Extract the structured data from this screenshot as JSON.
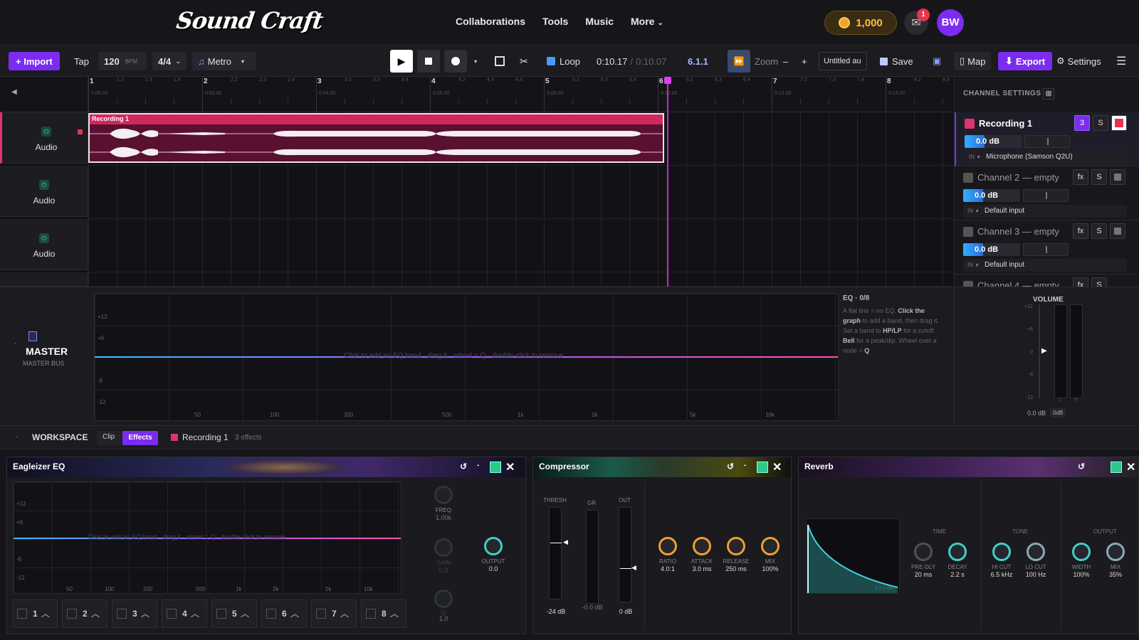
{
  "nav": {
    "brand": "Sound Craft",
    "links": [
      "Collaborations",
      "Tools",
      "Music",
      "More"
    ],
    "coins": "1,000",
    "mail_badge": "1",
    "avatar": "BW"
  },
  "toolbar": {
    "import": "+ Import",
    "tap": "Tap",
    "bpm": "120",
    "bpm_unit": "BPM",
    "time_sig": "4/4",
    "metro": "Metro",
    "loop": "Loop",
    "time_current": "0:10.17",
    "time_sep": "/",
    "time_total": "0:10.07",
    "position": "6.1.1",
    "zoom": "Zoom",
    "zoom_minus": "–",
    "zoom_plus": "+",
    "project_name": "Untitled au",
    "save": "Save",
    "map": "Map",
    "export": "Export",
    "settings": "Settings"
  },
  "ruler": {
    "bars": [
      "1",
      "2",
      "3",
      "4",
      "5",
      "6",
      "7",
      "8"
    ],
    "sub": [
      "1.2",
      "1.3",
      "1.4",
      "2.2",
      "2.3",
      "2.4",
      "3.2",
      "3.3",
      "3.4",
      "4.2",
      "4.3",
      "4.4",
      "5.2",
      "5.3",
      "5.4",
      "6.2",
      "6.3",
      "6.4",
      "7.2",
      "7.3",
      "7.4",
      "8.2",
      "8.3"
    ],
    "times": [
      "0:00.00",
      "0:02.00",
      "0:04.00",
      "0:06.00",
      "0:08.00",
      "0:10.00",
      "0:12.00",
      "0:14.00"
    ]
  },
  "tracks": [
    {
      "label": "Audio"
    },
    {
      "label": "Audio"
    },
    {
      "label": "Audio"
    }
  ],
  "clip": {
    "name": "Recording 1"
  },
  "channel_settings": {
    "title": "CHANNEL SETTINGS",
    "channels": [
      {
        "name": "Recording 1",
        "color": "#e0336e",
        "badge": "3",
        "solo": "S",
        "db": "0.0 dB",
        "in": "IN",
        "input": "Microphone (Samson Q2U)"
      },
      {
        "name": "Channel 2 — empty",
        "color": "#555",
        "badge": "fx",
        "solo": "S",
        "db": "0.0 dB",
        "in": "IN",
        "input": "Default input"
      },
      {
        "name": "Channel 3 — empty",
        "color": "#555",
        "badge": "fx",
        "solo": "S",
        "db": "0.0 dB",
        "in": "IN",
        "input": "Default input"
      },
      {
        "name": "Channel 4 — empty",
        "color": "#555",
        "badge": "fx",
        "solo": "S"
      }
    ]
  },
  "master": {
    "title": "MASTER",
    "subtitle": "MASTER BUS",
    "eq_y": [
      "+12",
      "+6",
      "-6",
      "-12"
    ],
    "eq_x": [
      "50",
      "100",
      "200",
      "500",
      "1k",
      "2k",
      "5k",
      "10k"
    ],
    "eq_hint": "Click to add an EQ band · drag it · wheel = Q · double-click to remove",
    "eq_title": "EQ · 0/8",
    "eq_help_1": "A flat line = no EQ.",
    "eq_help_b1": "Click the graph",
    "eq_help_2": "to add a band, then drag it. Set a band to",
    "eq_help_b2": "HP/LP",
    "eq_help_3": "for a cutoff.",
    "eq_help_b3": "Bell",
    "eq_help_4": "for a peak/dip. Wheel over a node =",
    "eq_help_b4": "Q",
    "volume_title": "VOLUME",
    "vol_scale": [
      "+12",
      "+6",
      "0",
      "-6",
      "-12"
    ],
    "vol_db": "0.0 dB",
    "vol_btn": "0dB",
    "meter_l": "L",
    "meter_r": "R"
  },
  "workspace": {
    "title": "WORKSPACE",
    "tab_clip": "Clip",
    "tab_effects": "Effects",
    "track": "Recording 1",
    "count": "3 effects"
  },
  "eaglizer": {
    "title": "Eagleizer EQ",
    "y": [
      "+12",
      "+6",
      "-6",
      "-12"
    ],
    "x": [
      "50",
      "100",
      "200",
      "500",
      "1k",
      "2k",
      "5k",
      "10k"
    ],
    "hint": "Click to add an EQ band · drag it · wheel = Q · double-click to remove",
    "freq_label": "FREQ",
    "freq_val": "1.00k",
    "gain_label": "GAIN",
    "gain_val": "0.0",
    "q_label": "Q",
    "q_val": "1.0",
    "output_label": "OUTPUT",
    "output_val": "0.0",
    "bands": [
      "1",
      "2",
      "3",
      "4",
      "5",
      "6",
      "7",
      "8"
    ]
  },
  "compressor": {
    "title": "Compressor",
    "thresh": "THRESH",
    "gr": "GR",
    "out": "OUT",
    "thresh_val": "-24 dB",
    "gr_val": "-0.0 dB",
    "out_val": "0 dB",
    "knobs": [
      {
        "label": "RATIO",
        "val": "4.0:1"
      },
      {
        "label": "ATTACK",
        "val": "3.0 ms"
      },
      {
        "label": "RELEASE",
        "val": "250 ms"
      },
      {
        "label": "MIX",
        "val": "100%"
      }
    ]
  },
  "reverb": {
    "title": "Reverb",
    "tail": "2.2 s tail",
    "time": "TIME",
    "tone": "TONE",
    "output": "OUTPUT",
    "knobs": [
      {
        "label": "PRE-DLY",
        "val": "20 ms"
      },
      {
        "label": "DECAY",
        "val": "2.2 s"
      },
      {
        "label": "HI CUT",
        "val": "6.5 kHz"
      },
      {
        "label": "LO CUT",
        "val": "100 Hz"
      },
      {
        "label": "WIDTH",
        "val": "100%"
      },
      {
        "label": "MIX",
        "val": "35%"
      }
    ]
  }
}
